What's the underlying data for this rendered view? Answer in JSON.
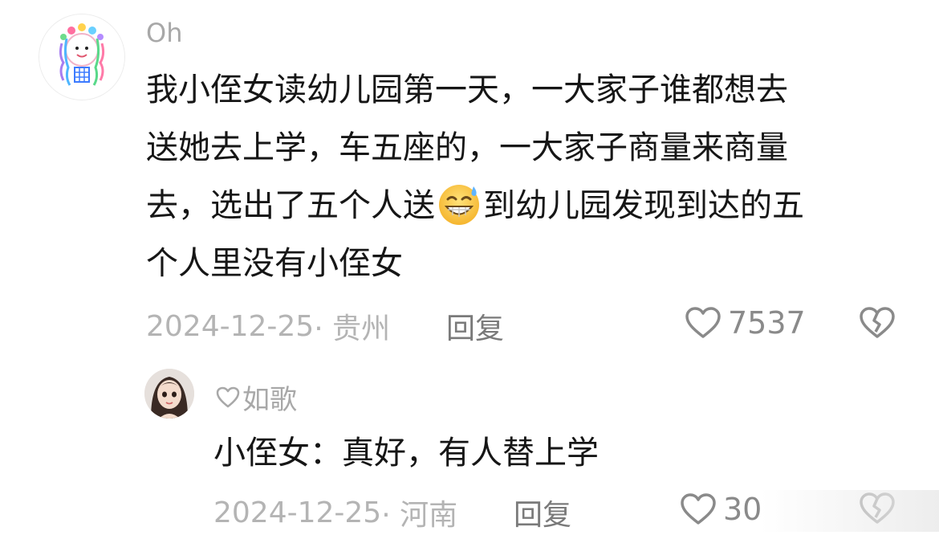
{
  "comment": {
    "username": "Oh",
    "text_lines": [
      "我小侄女读幼儿园第一天，一大家子谁都想去",
      "送她去上学，车五座的，一大家子商量来商量",
      "去，选出了五个人送",
      "个人里没有小侄女"
    ],
    "text_line3_after_emoji": "到幼儿园发现到达的五",
    "emoji": "grinning-sweat-emoji",
    "date": "2024-12-25",
    "location": "· 贵州",
    "reply_label": "回复",
    "like_count": "7537"
  },
  "reply": {
    "username": "如歌",
    "text": "小侄女：真好，有人替上学",
    "date": "2024-12-25",
    "location": "· 河南",
    "reply_label": "回复",
    "like_count": "30"
  },
  "colors": {
    "text": "#161616",
    "meta": "#b4b4b4",
    "icon": "#8a8a8a"
  },
  "icons": [
    "heart-outline-icon",
    "broken-heart-icon",
    "heart-small-icon"
  ]
}
